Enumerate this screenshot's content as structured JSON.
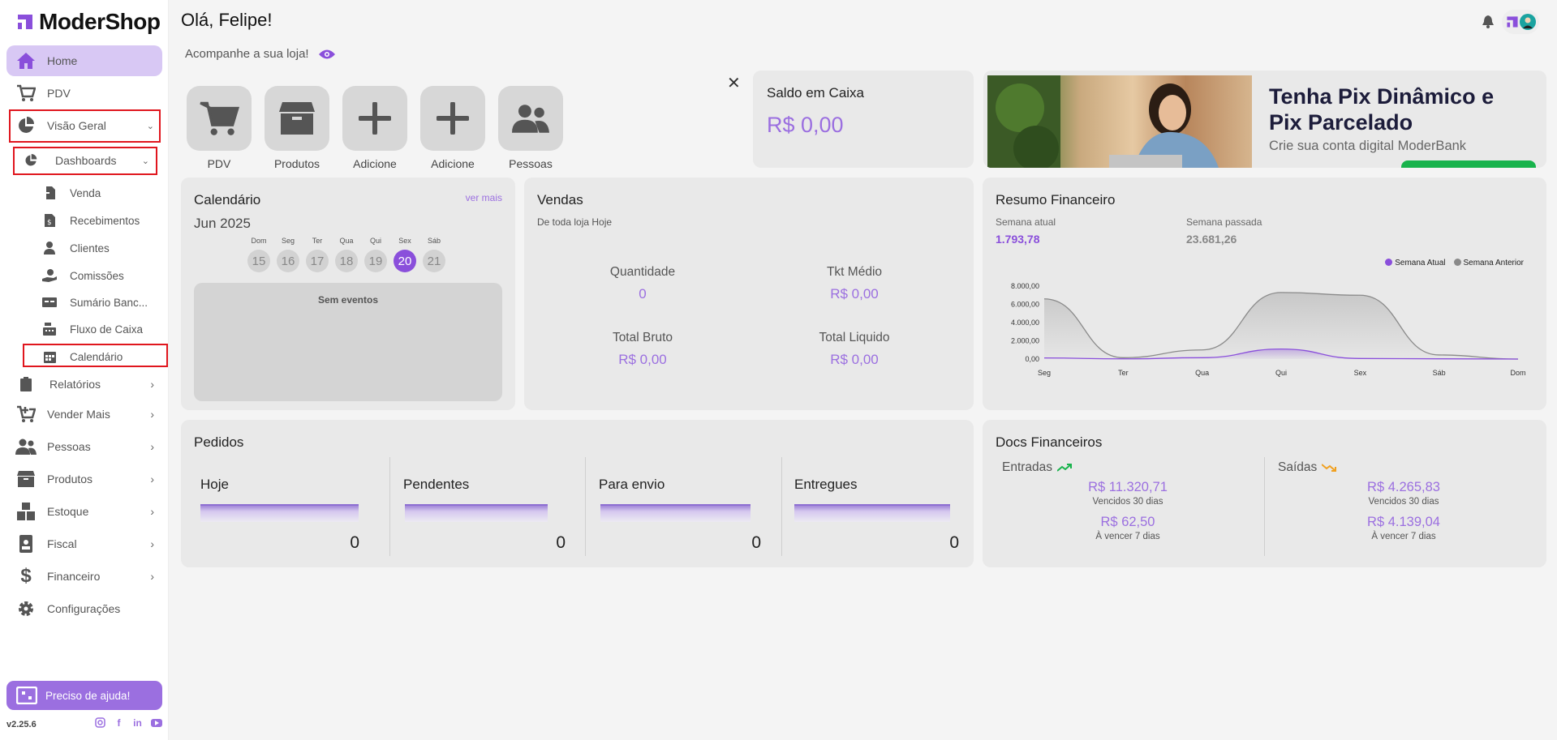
{
  "app": {
    "name": "ModerShop",
    "version": "v2.25.6"
  },
  "header": {
    "greeting": "Olá, Felipe!",
    "subtitle": "Acompanhe a sua loja!"
  },
  "sidebar": {
    "items": [
      {
        "label": "Home",
        "icon": "home-icon"
      },
      {
        "label": "PDV",
        "icon": "cart-icon"
      },
      {
        "label": "Visão Geral",
        "icon": "pie-chart-icon"
      },
      {
        "label": "Dashboards",
        "icon": "pie-chart-icon"
      },
      {
        "label": "Relatórios",
        "icon": "clipboard-icon"
      },
      {
        "label": "Vender Mais",
        "icon": "cart-plus-icon"
      },
      {
        "label": "Pessoas",
        "icon": "people-icon"
      },
      {
        "label": "Produtos",
        "icon": "box-icon"
      },
      {
        "label": "Estoque",
        "icon": "boxes-icon"
      },
      {
        "label": "Fiscal",
        "icon": "id-badge-icon"
      },
      {
        "label": "Financeiro",
        "icon": "dollar-icon"
      },
      {
        "label": "Configurações",
        "icon": "gear-icon"
      }
    ],
    "subitems": [
      {
        "label": "Venda",
        "icon": "file-import-icon"
      },
      {
        "label": "Recebimentos",
        "icon": "file-invoice-dollar-icon"
      },
      {
        "label": "Clientes",
        "icon": "user-icon"
      },
      {
        "label": "Comissões",
        "icon": "hand-holding-dollar-icon"
      },
      {
        "label": "Sumário Banc...",
        "icon": "money-check-icon"
      },
      {
        "label": "Fluxo de Caixa",
        "icon": "cash-register-icon"
      },
      {
        "label": "Calendário",
        "icon": "calendar-icon"
      }
    ],
    "help": "Preciso de ajuda!"
  },
  "shortcuts": [
    "PDV",
    "Produtos",
    "Adicione",
    "Adicione",
    "Pessoas"
  ],
  "saldo": {
    "title": "Saldo em Caixa",
    "value": "R$ 0,00"
  },
  "banner": {
    "title": "Tenha Pix Dinâmico e Pix Parcelado",
    "subtitle": "Crie sua conta digital ModerBank"
  },
  "calendar": {
    "title": "Calendário",
    "more": "ver mais",
    "month": "Jun 2025",
    "days": [
      {
        "name": "Dom",
        "num": "15"
      },
      {
        "name": "Seg",
        "num": "16"
      },
      {
        "name": "Ter",
        "num": "17"
      },
      {
        "name": "Qua",
        "num": "18"
      },
      {
        "name": "Qui",
        "num": "19"
      },
      {
        "name": "Sex",
        "num": "20",
        "selected": true
      },
      {
        "name": "Sáb",
        "num": "21"
      }
    ],
    "empty": "Sem eventos"
  },
  "vendas": {
    "title": "Vendas",
    "subtitle": "De toda loja Hoje",
    "stats": [
      {
        "label": "Quantidade",
        "value": "0"
      },
      {
        "label": "Tkt Médio",
        "value": "R$ 0,00"
      },
      {
        "label": "Total Bruto",
        "value": "R$ 0,00"
      },
      {
        "label": "Total Liquido",
        "value": "R$ 0,00"
      }
    ]
  },
  "resumo": {
    "title": "Resumo Financeiro",
    "current_label": "Semana atual",
    "current_value": "1.793,78",
    "previous_label": "Semana passada",
    "previous_value": "23.681,26"
  },
  "chart_data": {
    "type": "area",
    "categories": [
      "Seg",
      "Ter",
      "Qua",
      "Qui",
      "Sex",
      "Sáb",
      "Dom"
    ],
    "yticks": [
      "8.000,00",
      "6.000,00",
      "4.000,00",
      "2.000,00",
      "0,00"
    ],
    "ylim": [
      0,
      8000
    ],
    "legend_position": "top-right",
    "series": [
      {
        "name": "Semana Atual",
        "color": "#8a4fdb",
        "values": [
          120,
          20,
          150,
          1100,
          60,
          30,
          0
        ]
      },
      {
        "name": "Semana Anterior",
        "color": "#8a8a8a",
        "values": [
          6600,
          150,
          1000,
          7300,
          7000,
          450,
          0
        ]
      }
    ]
  },
  "pedidos": {
    "title": "Pedidos",
    "cols": [
      {
        "label": "Hoje",
        "value": "0"
      },
      {
        "label": "Pendentes",
        "value": "0"
      },
      {
        "label": "Para envio",
        "value": "0"
      },
      {
        "label": "Entregues",
        "value": "0"
      }
    ]
  },
  "docs": {
    "title": "Docs Financeiros",
    "entradas": {
      "label": "Entradas",
      "v1": "R$ 11.320,71",
      "l1": "Vencidos 30 dias",
      "v2": "R$ 62,50",
      "l2": "À vencer 7 dias"
    },
    "saidas": {
      "label": "Saídas",
      "v1": "R$ 4.265,83",
      "l1": "Vencidos 30 dias",
      "v2": "R$ 4.139,04",
      "l2": "À vencer 7 dias"
    }
  },
  "colors": {
    "accent": "#9b6fe0",
    "highlight": "#e0161e",
    "card": "#e9e9e9"
  }
}
